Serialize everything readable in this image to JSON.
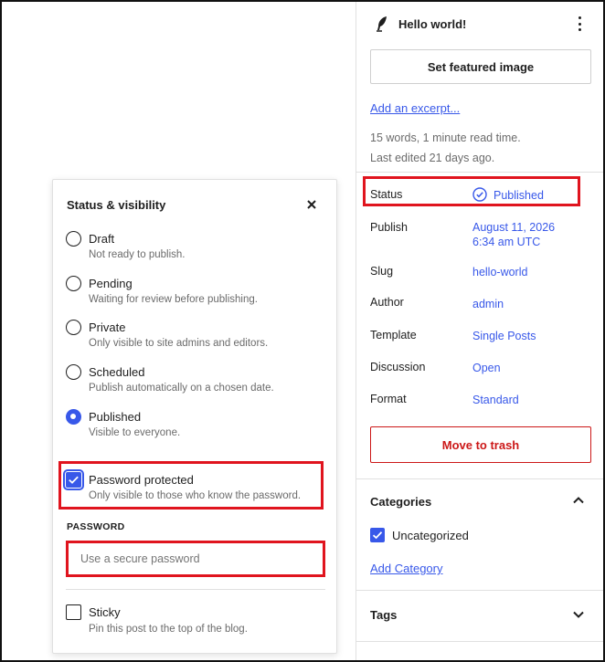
{
  "sidebar": {
    "post_title": "Hello world!",
    "featured_image_label": "Set featured image",
    "excerpt_link": "Add an excerpt...",
    "word_count": "15 words, 1 minute read time.",
    "last_edited": "Last edited 21 days ago.",
    "rows": {
      "status": {
        "label": "Status",
        "value": "Published"
      },
      "publish": {
        "label": "Publish",
        "value_line1": "August 11, 2026",
        "value_line2": "6:34 am UTC"
      },
      "slug": {
        "label": "Slug",
        "value": "hello-world"
      },
      "author": {
        "label": "Author",
        "value": "admin"
      },
      "template": {
        "label": "Template",
        "value": "Single Posts"
      },
      "discussion": {
        "label": "Discussion",
        "value": "Open"
      },
      "format": {
        "label": "Format",
        "value": "Standard"
      }
    },
    "trash_label": "Move to trash",
    "categories": {
      "title": "Categories",
      "items": [
        {
          "label": "Uncategorized",
          "checked": true
        }
      ],
      "add_link": "Add Category"
    },
    "tags": {
      "title": "Tags"
    }
  },
  "popover": {
    "title": "Status & visibility",
    "options": [
      {
        "label": "Draft",
        "desc": "Not ready to publish.",
        "checked": false
      },
      {
        "label": "Pending",
        "desc": "Waiting for review before publishing.",
        "checked": false
      },
      {
        "label": "Private",
        "desc": "Only visible to site admins and editors.",
        "checked": false
      },
      {
        "label": "Scheduled",
        "desc": "Publish automatically on a chosen date.",
        "checked": false
      },
      {
        "label": "Published",
        "desc": "Visible to everyone.",
        "checked": true
      }
    ],
    "password_protected": {
      "label": "Password protected",
      "desc": "Only visible to those who know the password.",
      "checked": true
    },
    "password_heading": "PASSWORD",
    "password_placeholder": "Use a secure password",
    "sticky": {
      "label": "Sticky",
      "desc": "Pin this post to the top of the blog.",
      "checked": false
    }
  },
  "colors": {
    "accent": "#3858e9",
    "danger": "#cc1818",
    "highlight": "#e0141e"
  }
}
